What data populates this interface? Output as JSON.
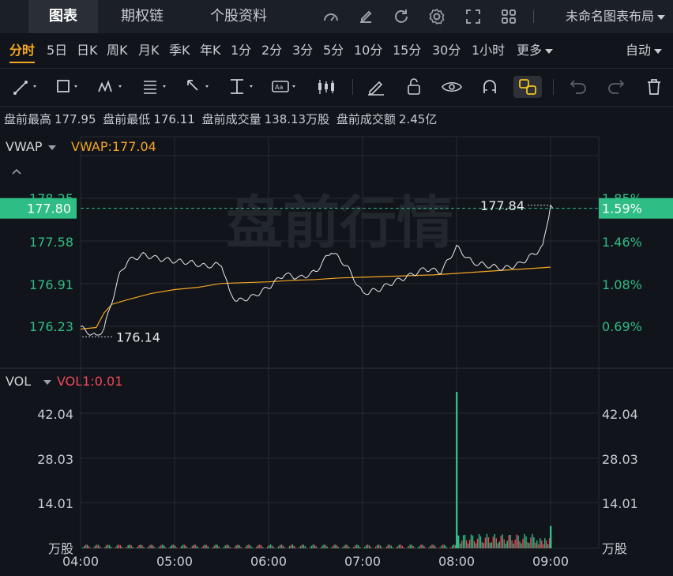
{
  "tabs": [
    {
      "label": "图表",
      "active": true
    },
    {
      "label": "期权链",
      "active": false
    },
    {
      "label": "个股资料",
      "active": false
    }
  ],
  "layout_name": "未命名图表布局",
  "timeframes": [
    "分时",
    "5日",
    "日K",
    "周K",
    "月K",
    "季K",
    "年K",
    "1分",
    "2分",
    "3分",
    "5分",
    "10分",
    "15分",
    "30分",
    "1小时",
    "更多"
  ],
  "auto_label": "自动",
  "stats": {
    "high_label": "盘前最高",
    "high_value": "177.95",
    "low_label": "盘前最低",
    "low_value": "176.11",
    "vol_label": "盘前成交量",
    "vol_value": "138.13万股",
    "amt_label": "盘前成交额",
    "amt_value": "2.45亿"
  },
  "price_panel": {
    "indicator_name": "VWAP",
    "indicator_value": "VWAP:177.04",
    "watermark": "盘前行情",
    "current_price": "177.80",
    "current_pct": "1.59%",
    "high_marker": "177.84",
    "low_marker": "176.14",
    "left_ticks": [
      "178.25",
      "177.58",
      "176.91",
      "176.23"
    ],
    "right_ticks": [
      "1.85%",
      "1.46%",
      "1.08%",
      "0.69%"
    ]
  },
  "volume_panel": {
    "indicator_name": "VOL",
    "indicator_value": "VOL1:0.01",
    "left_ticks": [
      "42.04",
      "28.03",
      "14.01",
      "万股"
    ],
    "right_ticks": [
      "42.04",
      "28.03",
      "14.01",
      "万股"
    ]
  },
  "x_labels": [
    "04:00",
    "05:00",
    "06:00",
    "07:00",
    "08:00",
    "09:00"
  ],
  "colors": {
    "up": "#2ebd85",
    "down": "#f0475b",
    "accent": "#f5a623",
    "vwap": "#f5a623",
    "price_line": "#e8eaed",
    "bg": "#11141a"
  },
  "chart_data": {
    "type": "line",
    "x_range": [
      "04:00",
      "09:00"
    ],
    "price": {
      "ylim": [
        176.0,
        178.45
      ],
      "series": [
        {
          "name": "VWAP",
          "points": [
            [
              "04:00",
              176.24
            ],
            [
              "04:10",
              176.26
            ],
            [
              "04:15",
              176.45
            ],
            [
              "04:20",
              176.56
            ],
            [
              "04:30",
              176.62
            ],
            [
              "04:45",
              176.7
            ],
            [
              "05:00",
              176.75
            ],
            [
              "05:15",
              176.78
            ],
            [
              "05:30",
              176.83
            ],
            [
              "05:45",
              176.84
            ],
            [
              "06:00",
              176.85
            ],
            [
              "06:15",
              176.87
            ],
            [
              "06:30",
              176.88
            ],
            [
              "06:45",
              176.9
            ],
            [
              "07:00",
              176.91
            ],
            [
              "07:15",
              176.92
            ],
            [
              "07:30",
              176.93
            ],
            [
              "07:45",
              176.94
            ],
            [
              "08:00",
              176.96
            ],
            [
              "08:15",
              176.98
            ],
            [
              "08:30",
              177.0
            ],
            [
              "08:45",
              177.02
            ],
            [
              "09:00",
              177.04
            ]
          ]
        },
        {
          "points": [
            [
              "04:00",
              176.26
            ],
            [
              "04:05",
              176.2
            ],
            [
              "04:10",
              176.14
            ],
            [
              "04:15",
              176.25
            ],
            [
              "04:20",
              176.6
            ],
            [
              "04:25",
              176.95
            ],
            [
              "04:30",
              177.12
            ],
            [
              "04:40",
              177.2
            ],
            [
              "04:50",
              177.15
            ],
            [
              "05:00",
              177.12
            ],
            [
              "05:10",
              177.1
            ],
            [
              "05:20",
              177.05
            ],
            [
              "05:30",
              177.08
            ],
            [
              "05:35",
              176.72
            ],
            [
              "05:40",
              176.6
            ],
            [
              "05:50",
              176.66
            ],
            [
              "06:00",
              176.78
            ],
            [
              "06:10",
              176.95
            ],
            [
              "06:20",
              176.9
            ],
            [
              "06:30",
              176.98
            ],
            [
              "06:40",
              177.25
            ],
            [
              "06:50",
              177.05
            ],
            [
              "07:00",
              176.7
            ],
            [
              "07:10",
              176.75
            ],
            [
              "07:20",
              176.85
            ],
            [
              "07:30",
              176.93
            ],
            [
              "07:40",
              177.02
            ],
            [
              "07:50",
              176.98
            ],
            [
              "08:00",
              177.3
            ],
            [
              "08:10",
              177.1
            ],
            [
              "08:20",
              177.06
            ],
            [
              "08:30",
              177.02
            ],
            [
              "08:40",
              177.08
            ],
            [
              "08:50",
              177.22
            ],
            [
              "08:55",
              177.3
            ],
            [
              "09:00",
              177.84
            ]
          ]
        }
      ]
    },
    "volume": {
      "ylim": [
        0,
        49
      ],
      "unit": "万股",
      "spikes": [
        [
          "08:00",
          49.0
        ],
        [
          "08:01",
          4.0
        ],
        [
          "09:00",
          7.0
        ]
      ]
    }
  }
}
